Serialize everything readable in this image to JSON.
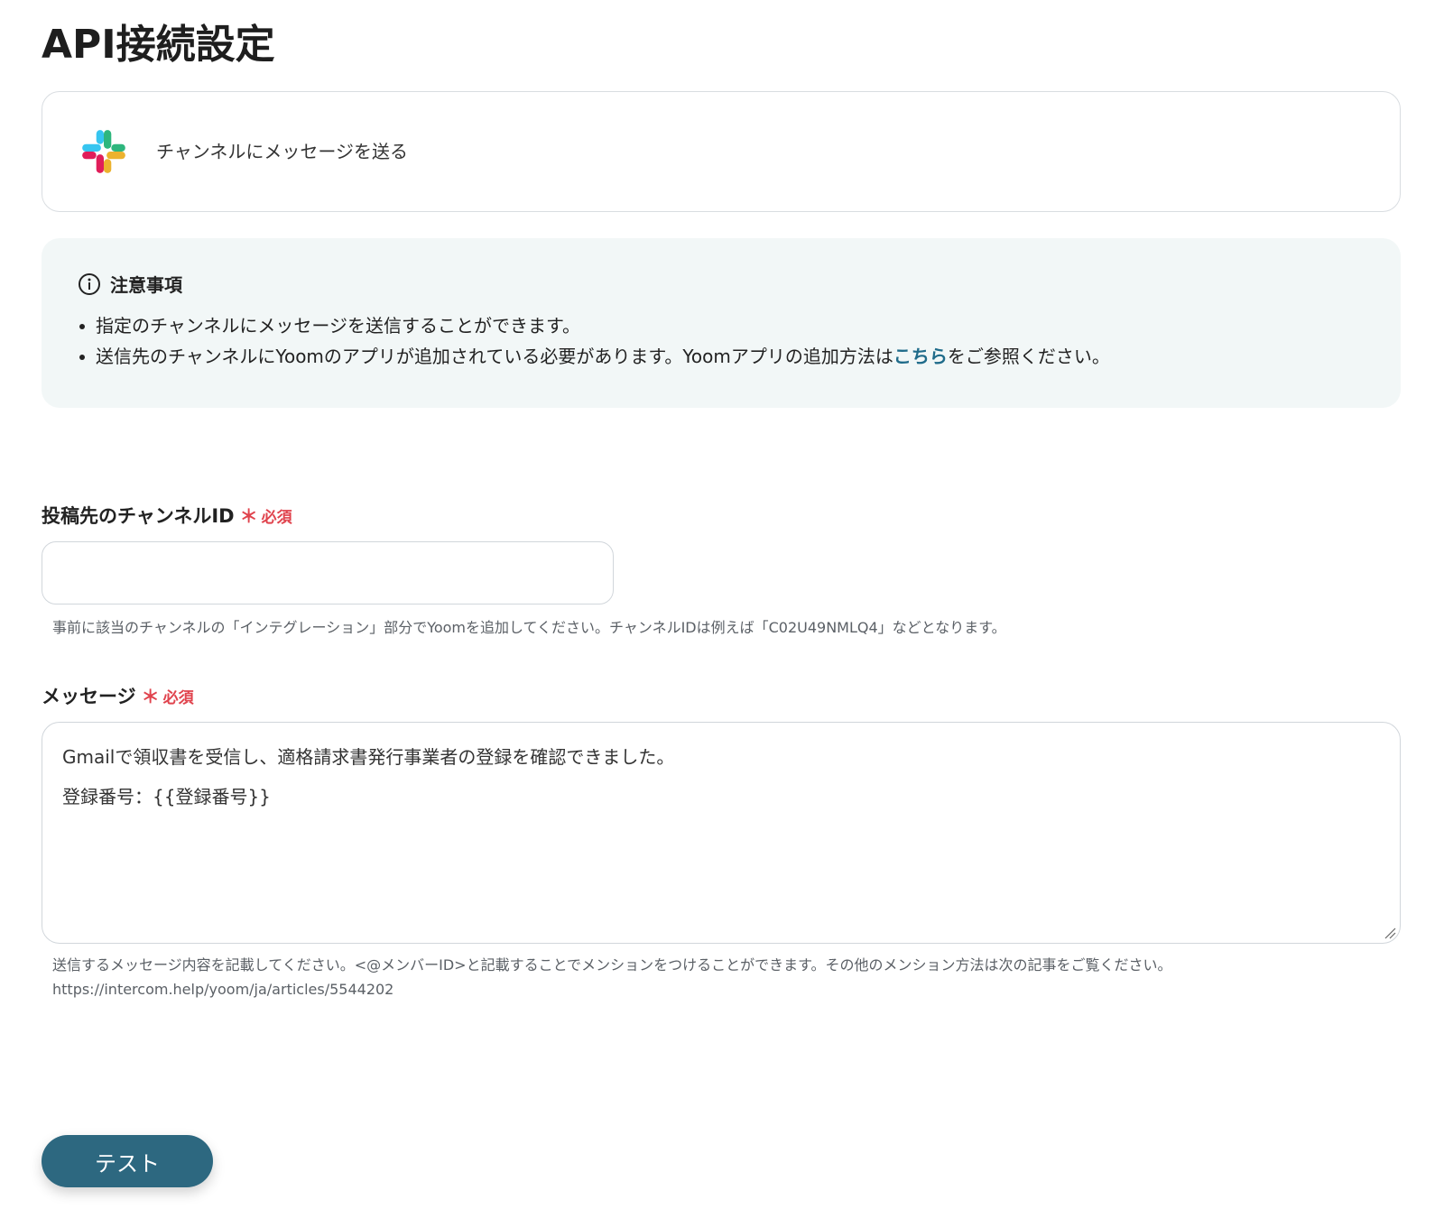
{
  "page": {
    "title": "API接続設定"
  },
  "action": {
    "app_icon": "slack-icon",
    "title": "チャンネルにメッセージを送る"
  },
  "notice": {
    "icon": "info-icon",
    "title": "注意事項",
    "items": [
      "指定のチャンネルにメッセージを送信することができます。",
      "送信先のチャンネルにYoomのアプリが追加されている必要があります。Yoomアプリの追加方法は"
    ],
    "link_text": "こちら",
    "item2_suffix": "をご参照ください。"
  },
  "fields": {
    "channel_id": {
      "label": "投稿先のチャンネルID",
      "required_mark": "＊",
      "required_text": "必須",
      "value": "",
      "placeholder": "",
      "help": "事前に該当のチャンネルの「インテグレーション」部分でYoomを追加してください。チャンネルIDは例えば「C02U49NMLQ4」などとなります。"
    },
    "message": {
      "label": "メッセージ",
      "required_mark": "＊",
      "required_text": "必須",
      "lines": [
        "Gmailで領収書を受信し、適格請求書発行事業者の登録を確認できました。",
        "登録番号：{{登録番号}}"
      ],
      "help_line1": "送信するメッセージ内容を記載してください。<@メンバーID>と記載することでメンションをつけることができます。その他のメンション方法は次の記事をご覧ください。",
      "help_line2": "https://intercom.help/yoom/ja/articles/5544202"
    }
  },
  "buttons": {
    "test_label": "テスト",
    "test_color": "#2d6880"
  },
  "colors": {
    "required": "#e0434d",
    "link": "#1f6b8a",
    "notice_bg": "#f2f7f7"
  }
}
